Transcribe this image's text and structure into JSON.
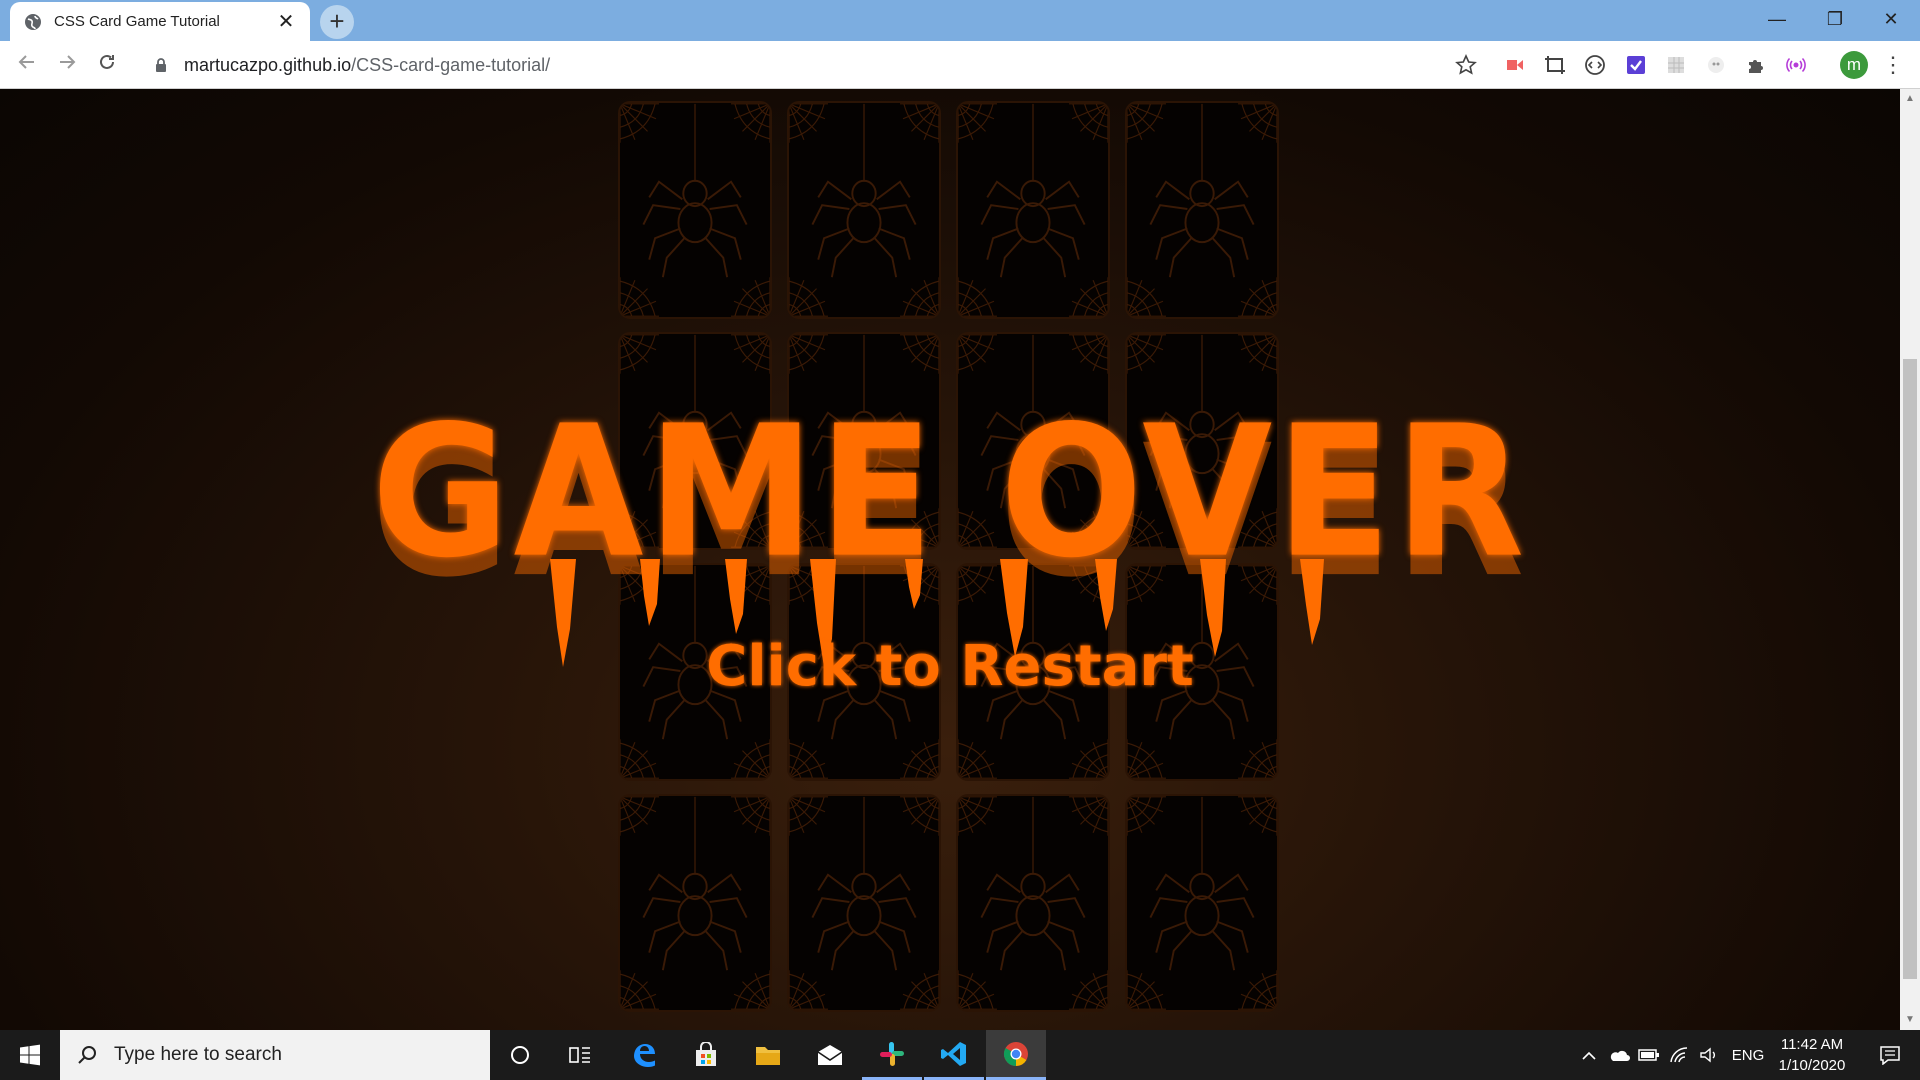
{
  "browser": {
    "tab_title": "CSS Card Game Tutorial",
    "tab_close": "✕",
    "new_tab": "+",
    "window_controls": {
      "minimize": "—",
      "restore": "❐",
      "close": "✕"
    },
    "url_domain": "martucazpo.github.io",
    "url_path": "/CSS-card-game-tutorial/",
    "profile_initial": "m",
    "menu": "⋮",
    "extensions": [
      "bookmark-star-icon",
      "screencast-icon",
      "screenshot-icon",
      "code-icon",
      "checkmark-extension-icon",
      "grid-extension-icon",
      "spider-extension-icon",
      "puzzle-icon",
      "broadcast-icon"
    ]
  },
  "game": {
    "title": "GAME OVER",
    "restart_label": "Click to Restart",
    "card_count": 16,
    "accent_color": "#ff6d00",
    "card_line_color": "#3a1a06"
  },
  "taskbar": {
    "search_placeholder": "Type here to search",
    "apps": [
      "cortana-icon",
      "task-view-icon",
      "edge-icon",
      "store-icon",
      "file-explorer-icon",
      "mail-icon",
      "slack-icon",
      "vscode-icon",
      "chrome-icon"
    ],
    "language": "ENG",
    "time": "11:42 AM",
    "date": "1/10/2020"
  }
}
